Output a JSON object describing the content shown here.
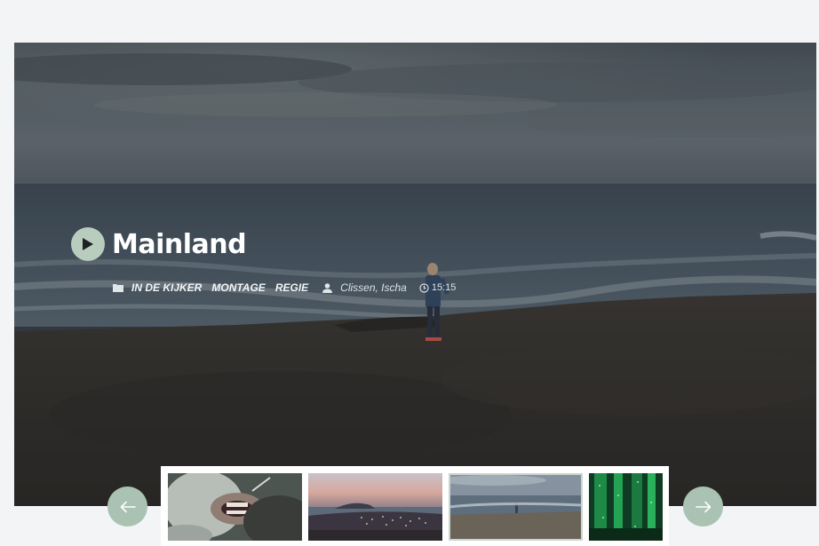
{
  "hero": {
    "title": "Mainland",
    "categories": [
      "IN DE KIJKER",
      "MONTAGE",
      "REGIE"
    ],
    "author": "Clissen, Ischa",
    "duration": "15:15",
    "icons": {
      "play": "play-icon",
      "category": "folder-icon",
      "author": "user-icon",
      "duration": "clock-icon"
    }
  },
  "carousel": {
    "prev_icon": "arrow-left-icon",
    "next_icon": "arrow-right-icon",
    "active_index": 2,
    "thumbnails": [
      {
        "name": "dental-procedure"
      },
      {
        "name": "coastal-town-dusk"
      },
      {
        "name": "mainland-coast"
      },
      {
        "name": "green-forest"
      }
    ]
  },
  "colors": {
    "accent": "#a9c2b1",
    "play": "#b9cdbf",
    "background": "#f3f4f5"
  }
}
